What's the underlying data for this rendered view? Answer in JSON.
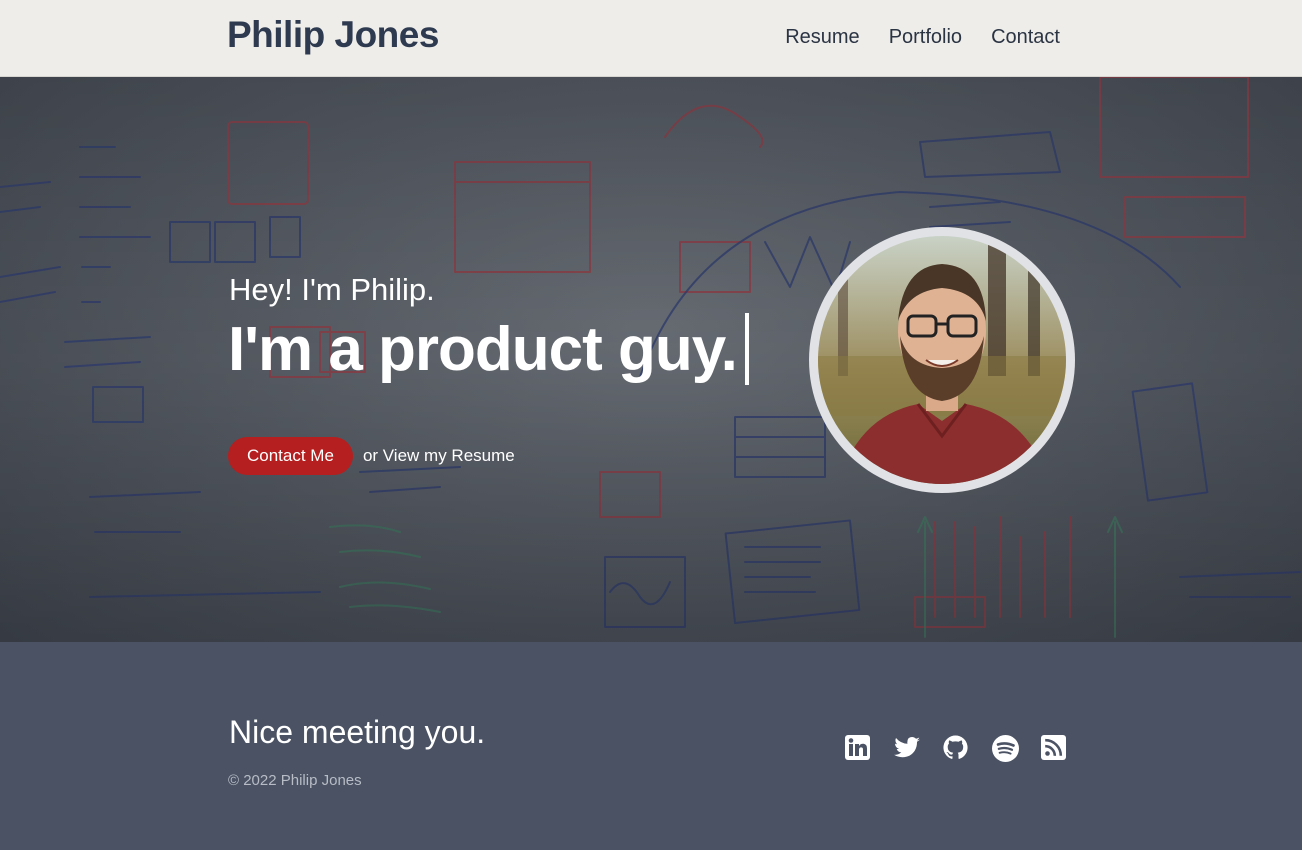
{
  "header": {
    "brand": "Philip Jones",
    "nav": [
      {
        "label": "Resume"
      },
      {
        "label": "Portfolio"
      },
      {
        "label": "Contact"
      }
    ]
  },
  "hero": {
    "greeting": "Hey! I'm Philip.",
    "tagline": "I'm a product guy.",
    "contact_button": "Contact Me",
    "resume_link": "or View my Resume",
    "avatar_alt": "Portrait of Philip Jones"
  },
  "footer": {
    "title": "Nice meeting you.",
    "copyright": "© 2022 Philip Jones",
    "social": [
      {
        "name": "linkedin-icon"
      },
      {
        "name": "twitter-icon"
      },
      {
        "name": "github-icon"
      },
      {
        "name": "spotify-icon"
      },
      {
        "name": "rss-icon"
      }
    ]
  },
  "colors": {
    "header_bg": "#eeedea",
    "brand": "#2e3a4f",
    "accent": "#b51f1f",
    "footer_bg": "#4a5263"
  }
}
